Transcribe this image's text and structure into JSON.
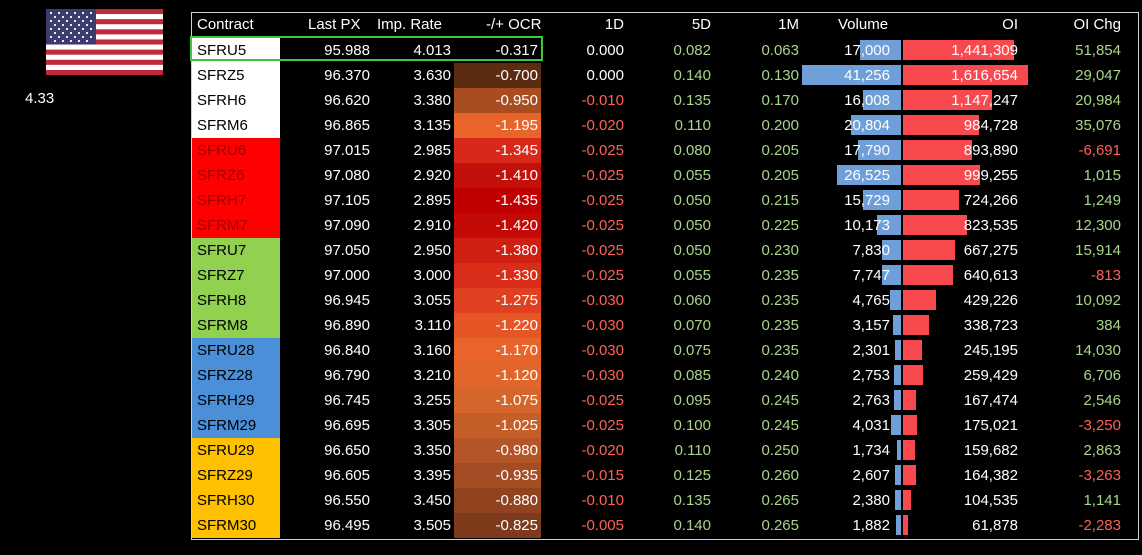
{
  "ocr_label": "4.33",
  "colors": {
    "positive": "#a8d58b",
    "negative": "#ff6157",
    "highlight": "#3dc83a",
    "volume_bar": "#6f9fd8",
    "oi_bar": "#f8494f",
    "groups": {
      "white": "#ffffff",
      "red": "#ff0000",
      "green": "#92d050",
      "blue": "#4a8fd8",
      "amber": "#ffc000"
    }
  },
  "headers": [
    "Contract",
    "Last PX",
    "Imp. Rate",
    "-/+ OCR",
    "1D",
    "5D",
    "1M",
    "Volume",
    "OI",
    "OI Chg"
  ],
  "rows": [
    {
      "contract": "SFRU5",
      "last": "95.988",
      "rate": "4.013",
      "ocr": "-0.317",
      "d1": "0.000",
      "d5": "0.082",
      "m1": "0.063",
      "vol": "17,000",
      "oi": "1,441,309",
      "oichg": "51,854",
      "group": "white",
      "ocr_color": "#000000",
      "d1s": "zero",
      "d5s": "pos",
      "m1s": "pos",
      "chgs": "pos",
      "vol_n": 17000,
      "oi_n": 1441309
    },
    {
      "contract": "SFRZ5",
      "last": "96.370",
      "rate": "3.630",
      "ocr": "-0.700",
      "d1": "0.000",
      "d5": "0.140",
      "m1": "0.130",
      "vol": "41,256",
      "oi": "1,616,654",
      "oichg": "29,047",
      "group": "white",
      "ocr_color": "#5c2c12",
      "d1s": "zero",
      "d5s": "pos",
      "m1s": "pos",
      "chgs": "pos",
      "vol_n": 41256,
      "oi_n": 1616654
    },
    {
      "contract": "SFRH6",
      "last": "96.620",
      "rate": "3.380",
      "ocr": "-0.950",
      "d1": "-0.010",
      "d5": "0.135",
      "m1": "0.170",
      "vol": "16,008",
      "oi": "1,147,247",
      "oichg": "20,984",
      "group": "white",
      "ocr_color": "#a74d20",
      "d1s": "neg",
      "d5s": "pos",
      "m1s": "pos",
      "chgs": "pos",
      "vol_n": 16008,
      "oi_n": 1147247
    },
    {
      "contract": "SFRM6",
      "last": "96.865",
      "rate": "3.135",
      "ocr": "-1.195",
      "d1": "-0.020",
      "d5": "0.110",
      "m1": "0.200",
      "vol": "20,804",
      "oi": "984,728",
      "oichg": "35,076",
      "group": "white",
      "ocr_color": "#e8642a",
      "d1s": "neg",
      "d5s": "pos",
      "m1s": "pos",
      "chgs": "pos",
      "vol_n": 20804,
      "oi_n": 984728
    },
    {
      "contract": "SFRU6",
      "last": "97.015",
      "rate": "2.985",
      "ocr": "-1.345",
      "d1": "-0.025",
      "d5": "0.080",
      "m1": "0.205",
      "vol": "17,790",
      "oi": "893,890",
      "oichg": "-6,691",
      "group": "red",
      "ocr_color": "#d8281a",
      "d1s": "neg",
      "d5s": "pos",
      "m1s": "pos",
      "chgs": "neg",
      "vol_n": 17790,
      "oi_n": 893890
    },
    {
      "contract": "SFRZ6",
      "last": "97.080",
      "rate": "2.920",
      "ocr": "-1.410",
      "d1": "-0.025",
      "d5": "0.055",
      "m1": "0.205",
      "vol": "26,525",
      "oi": "999,255",
      "oichg": "1,015",
      "group": "red",
      "ocr_color": "#c4100b",
      "d1s": "neg",
      "d5s": "pos",
      "m1s": "pos",
      "chgs": "pos",
      "vol_n": 26525,
      "oi_n": 999255
    },
    {
      "contract": "SFRH7",
      "last": "97.105",
      "rate": "2.895",
      "ocr": "-1.435",
      "d1": "-0.025",
      "d5": "0.050",
      "m1": "0.215",
      "vol": "15,729",
      "oi": "724,266",
      "oichg": "1,249",
      "group": "red",
      "ocr_color": "#c00000",
      "d1s": "neg",
      "d5s": "pos",
      "m1s": "pos",
      "chgs": "pos",
      "vol_n": 15729,
      "oi_n": 724266
    },
    {
      "contract": "SFRM7",
      "last": "97.090",
      "rate": "2.910",
      "ocr": "-1.420",
      "d1": "-0.025",
      "d5": "0.050",
      "m1": "0.225",
      "vol": "10,173",
      "oi": "823,535",
      "oichg": "12,300",
      "group": "red",
      "ocr_color": "#c40a06",
      "d1s": "neg",
      "d5s": "pos",
      "m1s": "pos",
      "chgs": "pos",
      "vol_n": 10173,
      "oi_n": 823535
    },
    {
      "contract": "SFRU7",
      "last": "97.050",
      "rate": "2.950",
      "ocr": "-1.380",
      "d1": "-0.025",
      "d5": "0.050",
      "m1": "0.230",
      "vol": "7,830",
      "oi": "667,275",
      "oichg": "15,914",
      "group": "green",
      "ocr_color": "#cf1e12",
      "d1s": "neg",
      "d5s": "pos",
      "m1s": "pos",
      "chgs": "pos",
      "vol_n": 7830,
      "oi_n": 667275
    },
    {
      "contract": "SFRZ7",
      "last": "97.000",
      "rate": "3.000",
      "ocr": "-1.330",
      "d1": "-0.025",
      "d5": "0.055",
      "m1": "0.235",
      "vol": "7,747",
      "oi": "640,613",
      "oichg": "-813",
      "group": "green",
      "ocr_color": "#d92c19",
      "d1s": "neg",
      "d5s": "pos",
      "m1s": "pos",
      "chgs": "neg",
      "vol_n": 7747,
      "oi_n": 640613
    },
    {
      "contract": "SFRH8",
      "last": "96.945",
      "rate": "3.055",
      "ocr": "-1.275",
      "d1": "-0.030",
      "d5": "0.060",
      "m1": "0.235",
      "vol": "4,765",
      "oi": "429,226",
      "oichg": "10,092",
      "group": "green",
      "ocr_color": "#e0401f",
      "d1s": "neg",
      "d5s": "pos",
      "m1s": "pos",
      "chgs": "pos",
      "vol_n": 4765,
      "oi_n": 429226
    },
    {
      "contract": "SFRM8",
      "last": "96.890",
      "rate": "3.110",
      "ocr": "-1.220",
      "d1": "-0.030",
      "d5": "0.070",
      "m1": "0.235",
      "vol": "3,157",
      "oi": "338,723",
      "oichg": "384",
      "group": "green",
      "ocr_color": "#e65526",
      "d1s": "neg",
      "d5s": "pos",
      "m1s": "pos",
      "chgs": "pos",
      "vol_n": 3157,
      "oi_n": 338723
    },
    {
      "contract": "SFRU28",
      "last": "96.840",
      "rate": "3.160",
      "ocr": "-1.170",
      "d1": "-0.030",
      "d5": "0.075",
      "m1": "0.235",
      "vol": "2,301",
      "oi": "245,195",
      "oichg": "14,030",
      "group": "blue",
      "ocr_color": "#e8642a",
      "d1s": "neg",
      "d5s": "pos",
      "m1s": "pos",
      "chgs": "pos",
      "vol_n": 2301,
      "oi_n": 245195
    },
    {
      "contract": "SFRZ28",
      "last": "96.790",
      "rate": "3.210",
      "ocr": "-1.120",
      "d1": "-0.030",
      "d5": "0.085",
      "m1": "0.240",
      "vol": "2,753",
      "oi": "259,429",
      "oichg": "6,706",
      "group": "blue",
      "ocr_color": "#e2662b",
      "d1s": "neg",
      "d5s": "pos",
      "m1s": "pos",
      "chgs": "pos",
      "vol_n": 2753,
      "oi_n": 259429
    },
    {
      "contract": "SFRH29",
      "last": "96.745",
      "rate": "3.255",
      "ocr": "-1.075",
      "d1": "-0.025",
      "d5": "0.095",
      "m1": "0.245",
      "vol": "2,763",
      "oi": "167,474",
      "oichg": "2,546",
      "group": "blue",
      "ocr_color": "#d6652c",
      "d1s": "neg",
      "d5s": "pos",
      "m1s": "pos",
      "chgs": "pos",
      "vol_n": 2763,
      "oi_n": 167474
    },
    {
      "contract": "SFRM29",
      "last": "96.695",
      "rate": "3.305",
      "ocr": "-1.025",
      "d1": "-0.025",
      "d5": "0.100",
      "m1": "0.245",
      "vol": "4,031",
      "oi": "175,021",
      "oichg": "-3,250",
      "group": "blue",
      "ocr_color": "#c65e2a",
      "d1s": "neg",
      "d5s": "pos",
      "m1s": "pos",
      "chgs": "neg",
      "vol_n": 4031,
      "oi_n": 175021
    },
    {
      "contract": "SFRU29",
      "last": "96.650",
      "rate": "3.350",
      "ocr": "-0.980",
      "d1": "-0.020",
      "d5": "0.110",
      "m1": "0.250",
      "vol": "1,734",
      "oi": "159,682",
      "oichg": "2,863",
      "group": "amber",
      "ocr_color": "#b45528",
      "d1s": "neg",
      "d5s": "pos",
      "m1s": "pos",
      "chgs": "pos",
      "vol_n": 1734,
      "oi_n": 159682
    },
    {
      "contract": "SFRZ29",
      "last": "96.605",
      "rate": "3.395",
      "ocr": "-0.935",
      "d1": "-0.015",
      "d5": "0.125",
      "m1": "0.260",
      "vol": "2,607",
      "oi": "164,382",
      "oichg": "-3,263",
      "group": "amber",
      "ocr_color": "#a44c24",
      "d1s": "neg",
      "d5s": "pos",
      "m1s": "pos",
      "chgs": "neg",
      "vol_n": 2607,
      "oi_n": 164382
    },
    {
      "contract": "SFRH30",
      "last": "96.550",
      "rate": "3.450",
      "ocr": "-0.880",
      "d1": "-0.010",
      "d5": "0.135",
      "m1": "0.265",
      "vol": "2,380",
      "oi": "104,535",
      "oichg": "1,141",
      "group": "amber",
      "ocr_color": "#914320",
      "d1s": "neg",
      "d5s": "pos",
      "m1s": "pos",
      "chgs": "pos",
      "vol_n": 2380,
      "oi_n": 104535
    },
    {
      "contract": "SFRM30",
      "last": "96.495",
      "rate": "3.505",
      "ocr": "-0.825",
      "d1": "-0.005",
      "d5": "0.140",
      "m1": "0.265",
      "vol": "1,882",
      "oi": "61,878",
      "oichg": "-2,283",
      "group": "amber",
      "ocr_color": "#7d3a1c",
      "d1s": "neg",
      "d5s": "pos",
      "m1s": "pos",
      "chgs": "neg",
      "vol_n": 1882,
      "oi_n": 61878
    }
  ]
}
